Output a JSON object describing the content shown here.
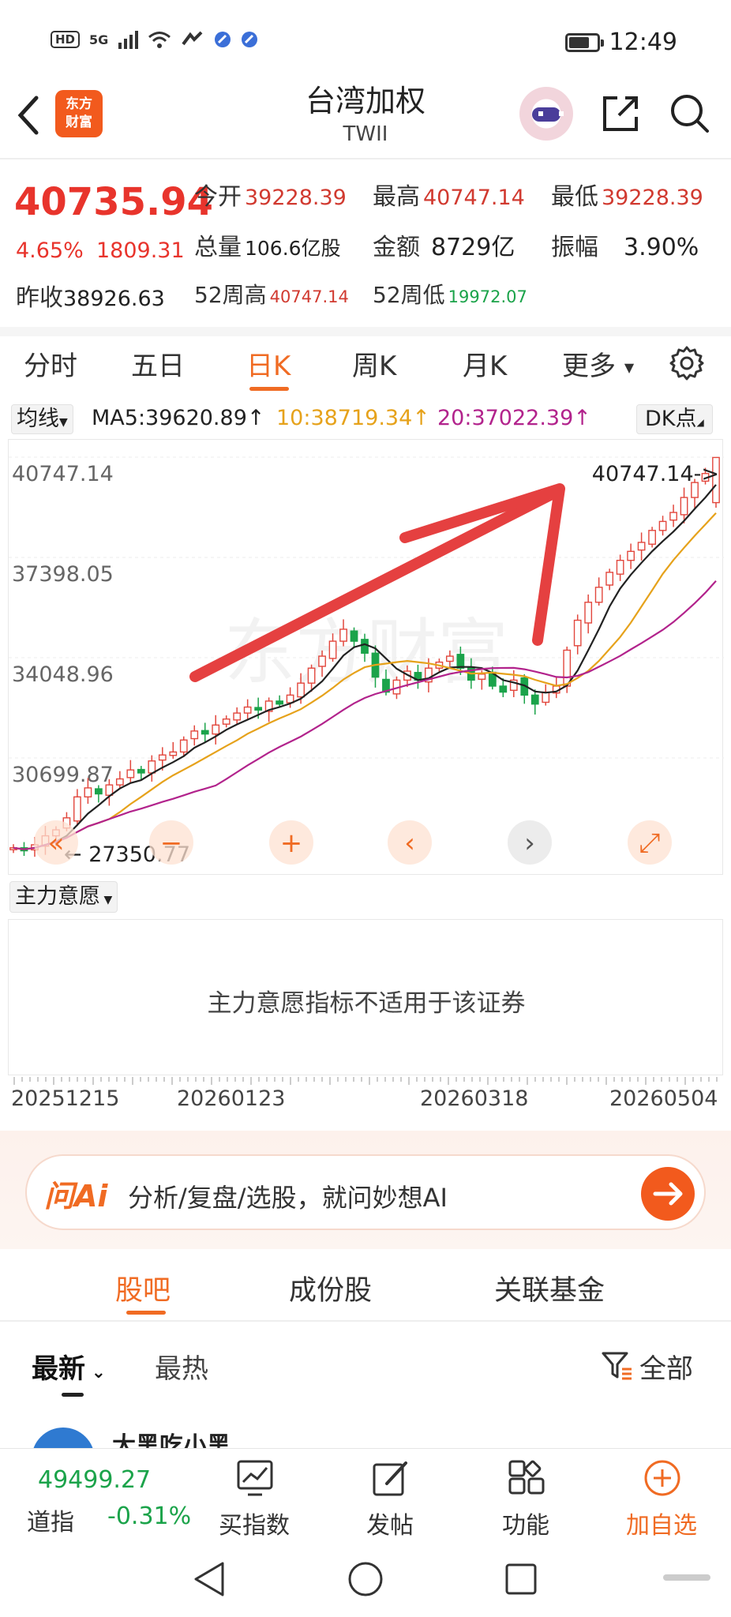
{
  "status_bar": {
    "left_badge": "HD",
    "network": "5G",
    "time": "12:49",
    "battery_fraction": 0.7
  },
  "header": {
    "logo_text_1": "东方",
    "logo_text_2": "财富",
    "title": "台湾加权",
    "subtitle": "TWII"
  },
  "quote": {
    "price": "40735.94",
    "change_pct": "4.65%",
    "change_value": "1809.31",
    "open": {
      "label": "今开",
      "value": "39228.39"
    },
    "high": {
      "label": "最高",
      "value": "40747.14"
    },
    "low": {
      "label": "最低",
      "value": "39228.39"
    },
    "volume": {
      "label": "总量",
      "value": "106.6亿股"
    },
    "amount": {
      "label": "金额",
      "value": "8729亿"
    },
    "amplitude": {
      "label": "振幅",
      "value": "3.90%"
    },
    "prev_close": {
      "label": "昨收",
      "value": "38926.63"
    },
    "week52_high": {
      "label": "52周高",
      "value": "40747.14"
    },
    "week52_low": {
      "label": "52周低",
      "value": "19972.07"
    }
  },
  "period_tabs": {
    "items": [
      "分时",
      "五日",
      "日K",
      "周K",
      "月K",
      "更多"
    ],
    "active": "日K"
  },
  "ma": {
    "button": "均线",
    "ma5": "MA5:39620.89",
    "ma10": "10:38719.34",
    "ma20": "20:37022.39",
    "dk_button": "DK点"
  },
  "chart_data": {
    "type": "candlestick",
    "y_ticks": [
      "40747.14",
      "37398.05",
      "34048.96",
      "30699.87"
    ],
    "y_range": [
      27350.77,
      40747.14
    ],
    "max_label": "40747.14->",
    "min_label": "27350.77",
    "x_ticks": [
      "20251215",
      "20260123",
      "20260318",
      "20260504"
    ],
    "watermark": "东方财富",
    "closes": [
      27700,
      27600,
      27800,
      28100,
      28300,
      28700,
      29400,
      29700,
      29500,
      29800,
      30000,
      30300,
      30200,
      30600,
      30800,
      30900,
      31300,
      31600,
      31500,
      31800,
      32000,
      32200,
      32400,
      32300,
      32600,
      32500,
      32800,
      33200,
      33700,
      34100,
      34600,
      35000,
      34600,
      34200,
      33400,
      32900,
      33300,
      33600,
      33300,
      33700,
      33900,
      34100,
      33700,
      33300,
      33500,
      33100,
      32900,
      33300,
      32800,
      32500,
      32900,
      33100,
      34300,
      35300,
      35900,
      36400,
      36900,
      37300,
      37600,
      37900,
      38300,
      38600,
      38900,
      39400,
      39900,
      40200,
      40735.94
    ],
    "ma_colors": {
      "ma5": "#222222",
      "ma10": "#e6a21b",
      "ma20": "#b2238c"
    },
    "up_color": "#e2473d",
    "down_color": "#1ba34a"
  },
  "sub_indicator": {
    "button": "主力意愿",
    "message": "主力意愿指标不适用于该证券"
  },
  "ai_bar": {
    "logo": "问Ai",
    "text": "分析/复盘/选股，就问妙想AI"
  },
  "section_tabs": {
    "items": [
      "股吧",
      "成份股",
      "关联基金"
    ],
    "active": "股吧"
  },
  "feed_tabs": {
    "latest": "最新",
    "hot": "最热",
    "filter": "全部",
    "peek_user": "大黑吃小黑"
  },
  "bottom_nav": {
    "dj_value": "49499.27",
    "dj_name": "道指",
    "dj_pct": "-0.31%",
    "buy_index": "买指数",
    "post": "发帖",
    "functions": "功能",
    "add_watch": "加自选"
  },
  "accent_color": "#f06b23"
}
